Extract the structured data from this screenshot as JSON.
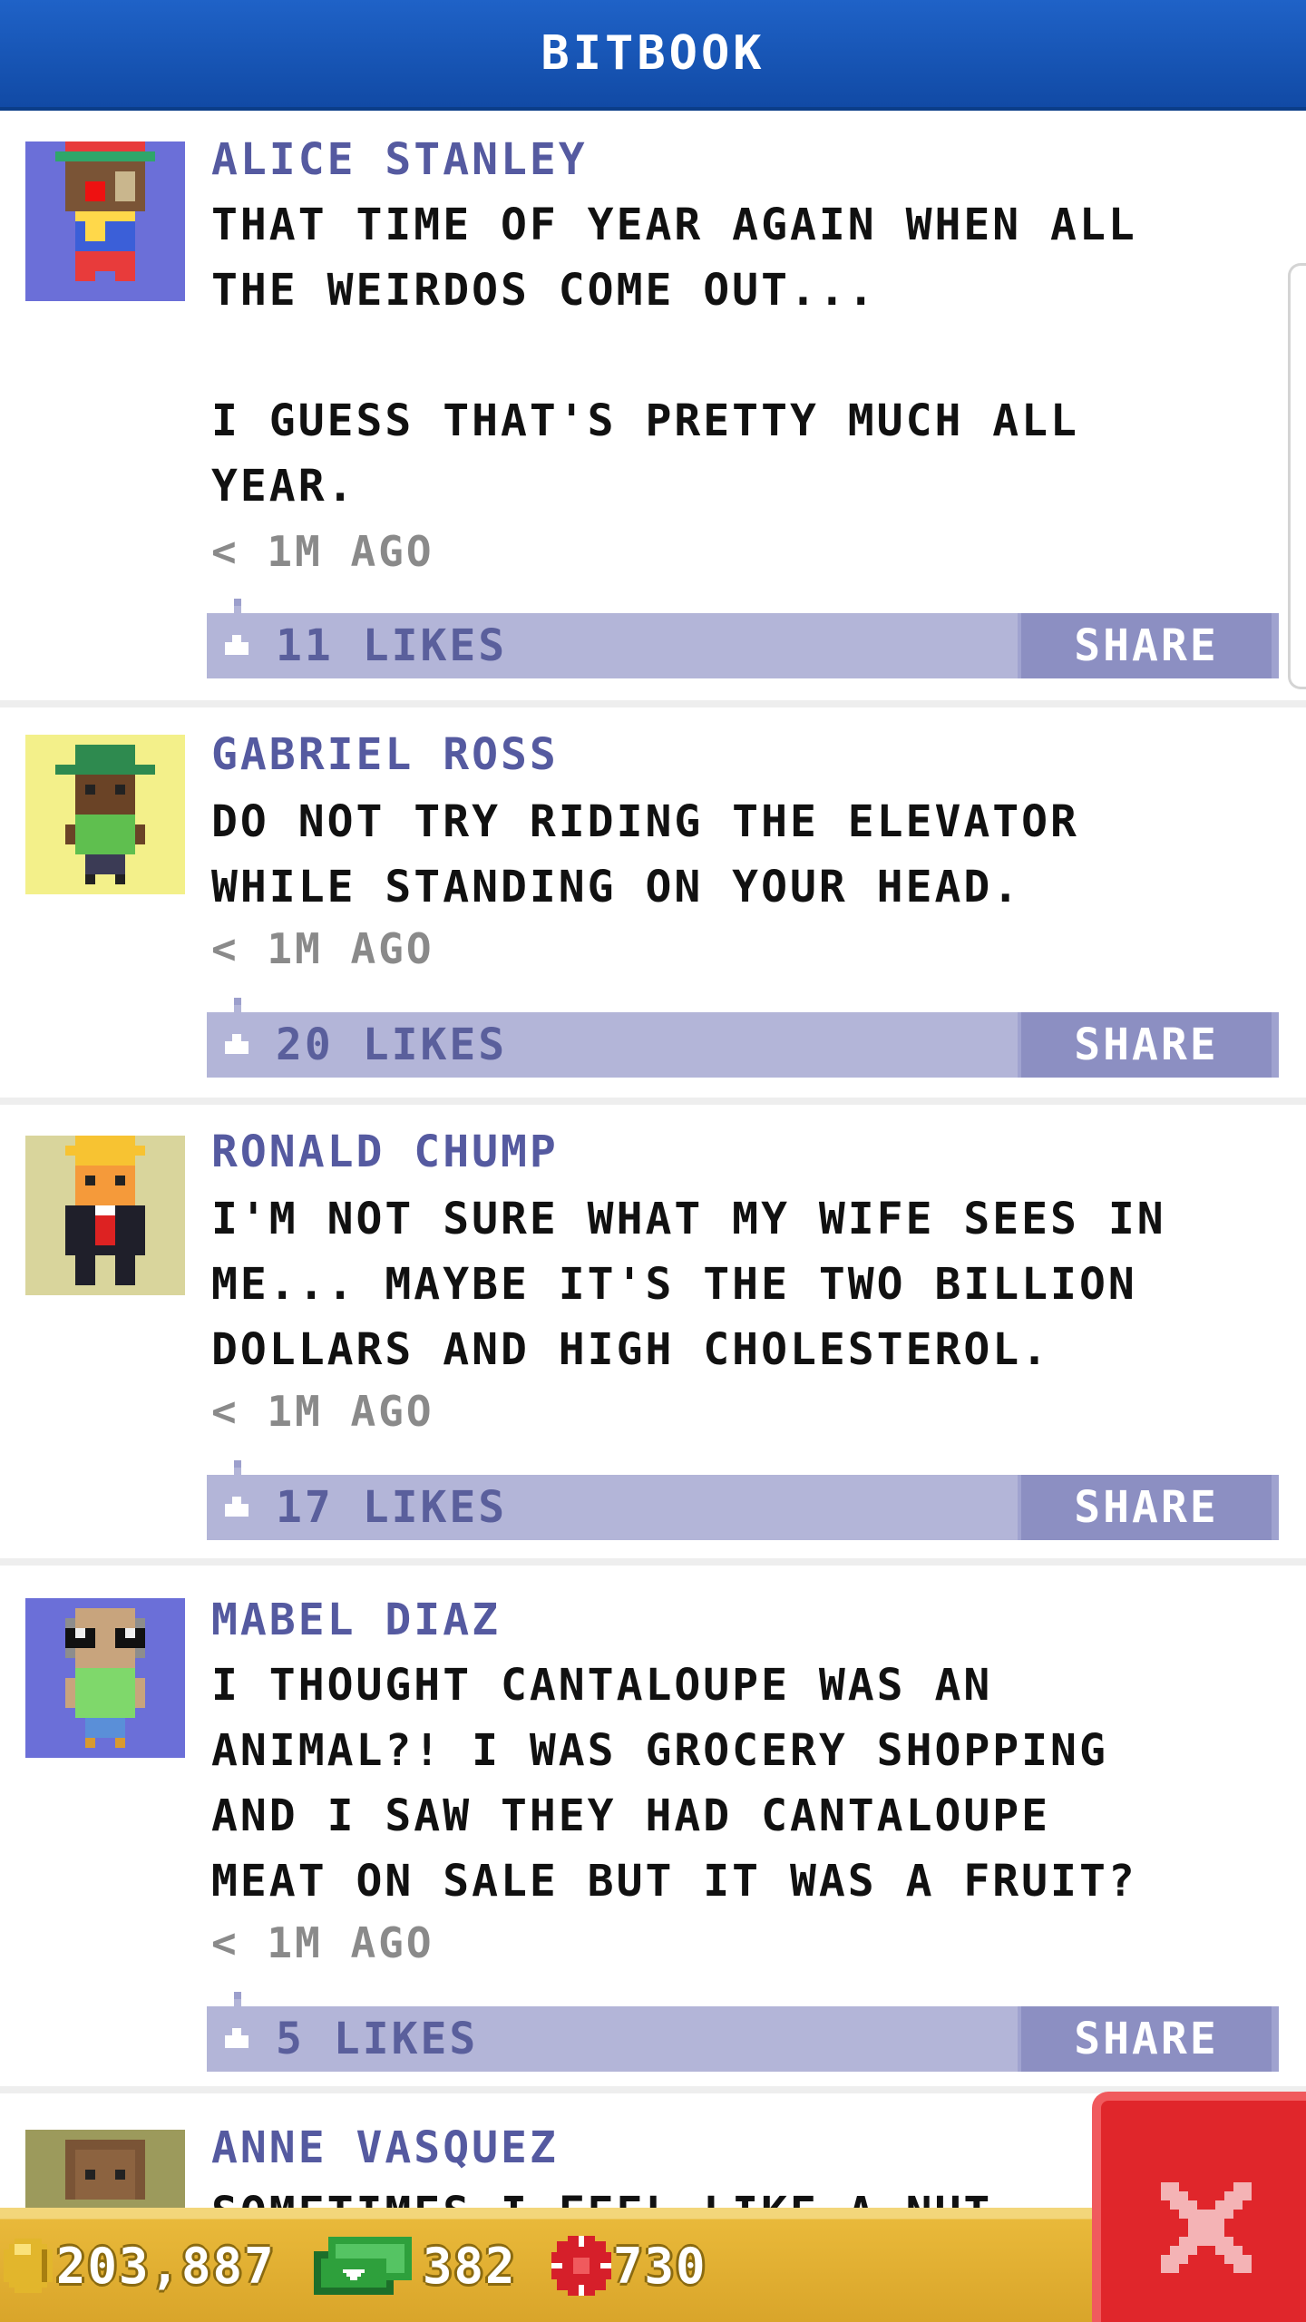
{
  "header": {
    "title": "BITBOOK"
  },
  "colors": {
    "header_bg": "#1a56b8",
    "likes_bar": "#b3b5d8",
    "share_button": "#8c8fc2",
    "author_text": "#555aa0",
    "close_button": "#e0262b",
    "bottom_bar": "#e9b93a"
  },
  "posts": [
    {
      "author": "ALICE STANLEY",
      "text": "THAT TIME OF YEAR AGAIN WHEN ALL\nTHE WEIRDOS COME OUT...\n\nI GUESS THAT'S PRETTY MUCH ALL\nYEAR.",
      "time": "< 1M AGO",
      "likes": "11 LIKES",
      "share": "SHARE",
      "avatar_icon": "clown-avatar-icon"
    },
    {
      "author": "GABRIEL ROSS",
      "text": "DO NOT TRY RIDING THE ELEVATOR\nWHILE STANDING ON YOUR HEAD.",
      "time": "< 1M AGO",
      "likes": "20 LIKES",
      "share": "SHARE",
      "avatar_icon": "green-hat-avatar-icon"
    },
    {
      "author": "RONALD CHUMP",
      "text": "I'M NOT SURE WHAT MY WIFE SEES IN\nME... MAYBE IT'S THE TWO BILLION\nDOLLARS AND HIGH CHOLESTEROL.",
      "time": "< 1M AGO",
      "likes": "17 LIKES",
      "share": "SHARE",
      "avatar_icon": "blond-suit-avatar-icon"
    },
    {
      "author": "MABEL DIAZ",
      "text": "I THOUGHT CANTALOUPE WAS AN\nANIMAL?! I WAS GROCERY SHOPPING\nAND I SAW THEY HAD CANTALOUPE\nMEAT ON SALE BUT IT WAS A FRUIT?",
      "time": "< 1M AGO",
      "likes": "5 LIKES",
      "share": "SHARE",
      "avatar_icon": "glasses-avatar-icon"
    },
    {
      "author": "ANNE VASQUEZ",
      "text": "SOMETIMES I FEEL LIKE A NUT",
      "time": "",
      "likes": "",
      "share": "",
      "avatar_icon": "brown-hair-avatar-icon"
    }
  ],
  "stats": {
    "coins": "203,887",
    "bux": "382",
    "tokens": "730"
  },
  "icons": {
    "coin": "coin-icon",
    "bux": "bux-icon",
    "token": "token-icon",
    "close": "close-icon",
    "like": "thumbs-up-icon"
  }
}
